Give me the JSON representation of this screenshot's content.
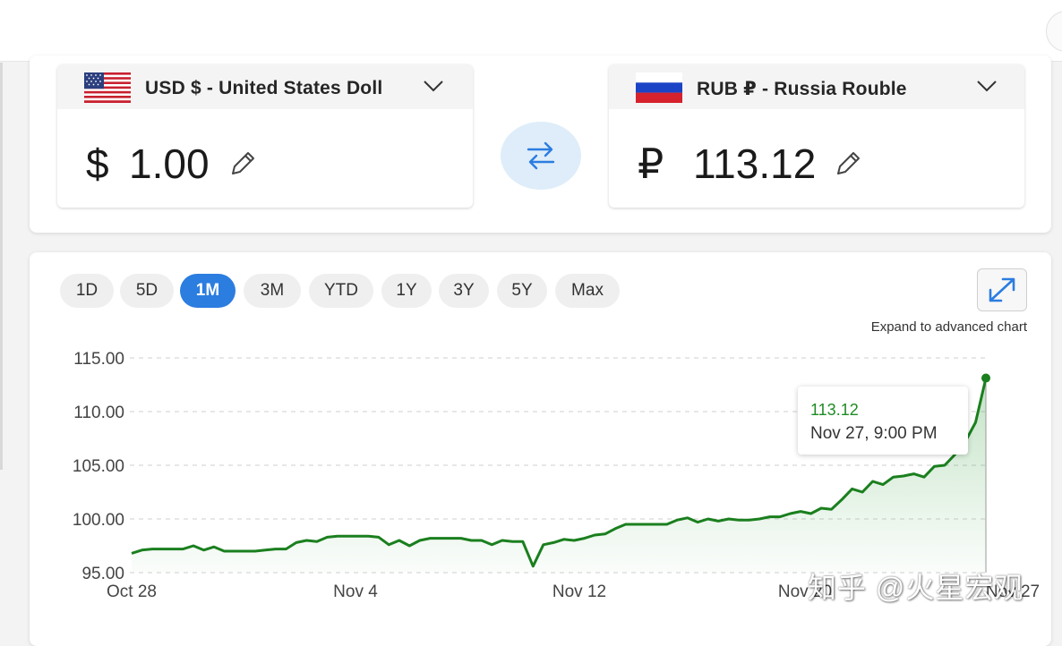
{
  "converter": {
    "from": {
      "currency_label": "USD $ - United States Doll",
      "symbol": "$",
      "amount": "1.00",
      "flag_icon": "us-flag-icon"
    },
    "to": {
      "currency_label": "RUB ₽ - Russia Rouble",
      "symbol": "₽",
      "amount": "113.12",
      "flag_icon": "russia-flag-icon"
    },
    "swap_icon": "swap-arrows-icon"
  },
  "chart_panel": {
    "ranges": [
      {
        "label": "1D",
        "active": false
      },
      {
        "label": "5D",
        "active": false
      },
      {
        "label": "1M",
        "active": true
      },
      {
        "label": "3M",
        "active": false
      },
      {
        "label": "YTD",
        "active": false
      },
      {
        "label": "1Y",
        "active": false
      },
      {
        "label": "3Y",
        "active": false
      },
      {
        "label": "5Y",
        "active": false
      },
      {
        "label": "Max",
        "active": false
      }
    ],
    "expand_label": "Expand to advanced chart",
    "tooltip": {
      "value": "113.12",
      "date": "Nov 27, 9:00 PM"
    },
    "accent_color": "#2b7de0",
    "line_color": "#1a7f1e"
  },
  "watermark": "知乎 @火星宏观",
  "chart_data": {
    "type": "line",
    "title": "",
    "xlabel": "",
    "ylabel": "",
    "x_tick_labels": [
      "Oct 28",
      "Nov 4",
      "Nov 12",
      "Nov 20",
      "Nov 27"
    ],
    "y_tick_labels": [
      "115.00",
      "110.00",
      "105.00",
      "100.00",
      "95.00"
    ],
    "ylim": [
      95,
      115
    ],
    "grid": true,
    "series": [
      {
        "values": [
          96.8,
          97.1,
          97.2,
          97.2,
          97.2,
          97.2,
          97.5,
          97.1,
          97.4,
          97.0,
          97.0,
          97.0,
          97.0,
          97.1,
          97.2,
          97.2,
          97.8,
          98.0,
          97.9,
          98.3,
          98.4,
          98.4,
          98.4,
          98.4,
          98.3,
          97.6,
          98.0,
          97.5,
          98.0,
          98.2,
          98.2,
          98.2,
          98.2,
          98.0,
          98.0,
          97.6,
          98.0,
          97.9,
          97.9,
          95.6,
          97.6,
          97.8,
          98.1,
          98.0,
          98.2,
          98.5,
          98.6,
          99.1,
          99.5,
          99.5,
          99.5,
          99.5,
          99.5,
          99.9,
          100.1,
          99.7,
          100.0,
          99.8,
          100.0,
          99.9,
          99.9,
          100.0,
          100.2,
          100.2,
          100.5,
          100.7,
          100.5,
          101.0,
          100.9,
          101.8,
          102.8,
          102.5,
          103.5,
          103.2,
          103.9,
          104.0,
          104.2,
          103.9,
          104.9,
          105.0,
          106.0,
          107.2,
          109.0,
          113.12
        ]
      }
    ]
  }
}
